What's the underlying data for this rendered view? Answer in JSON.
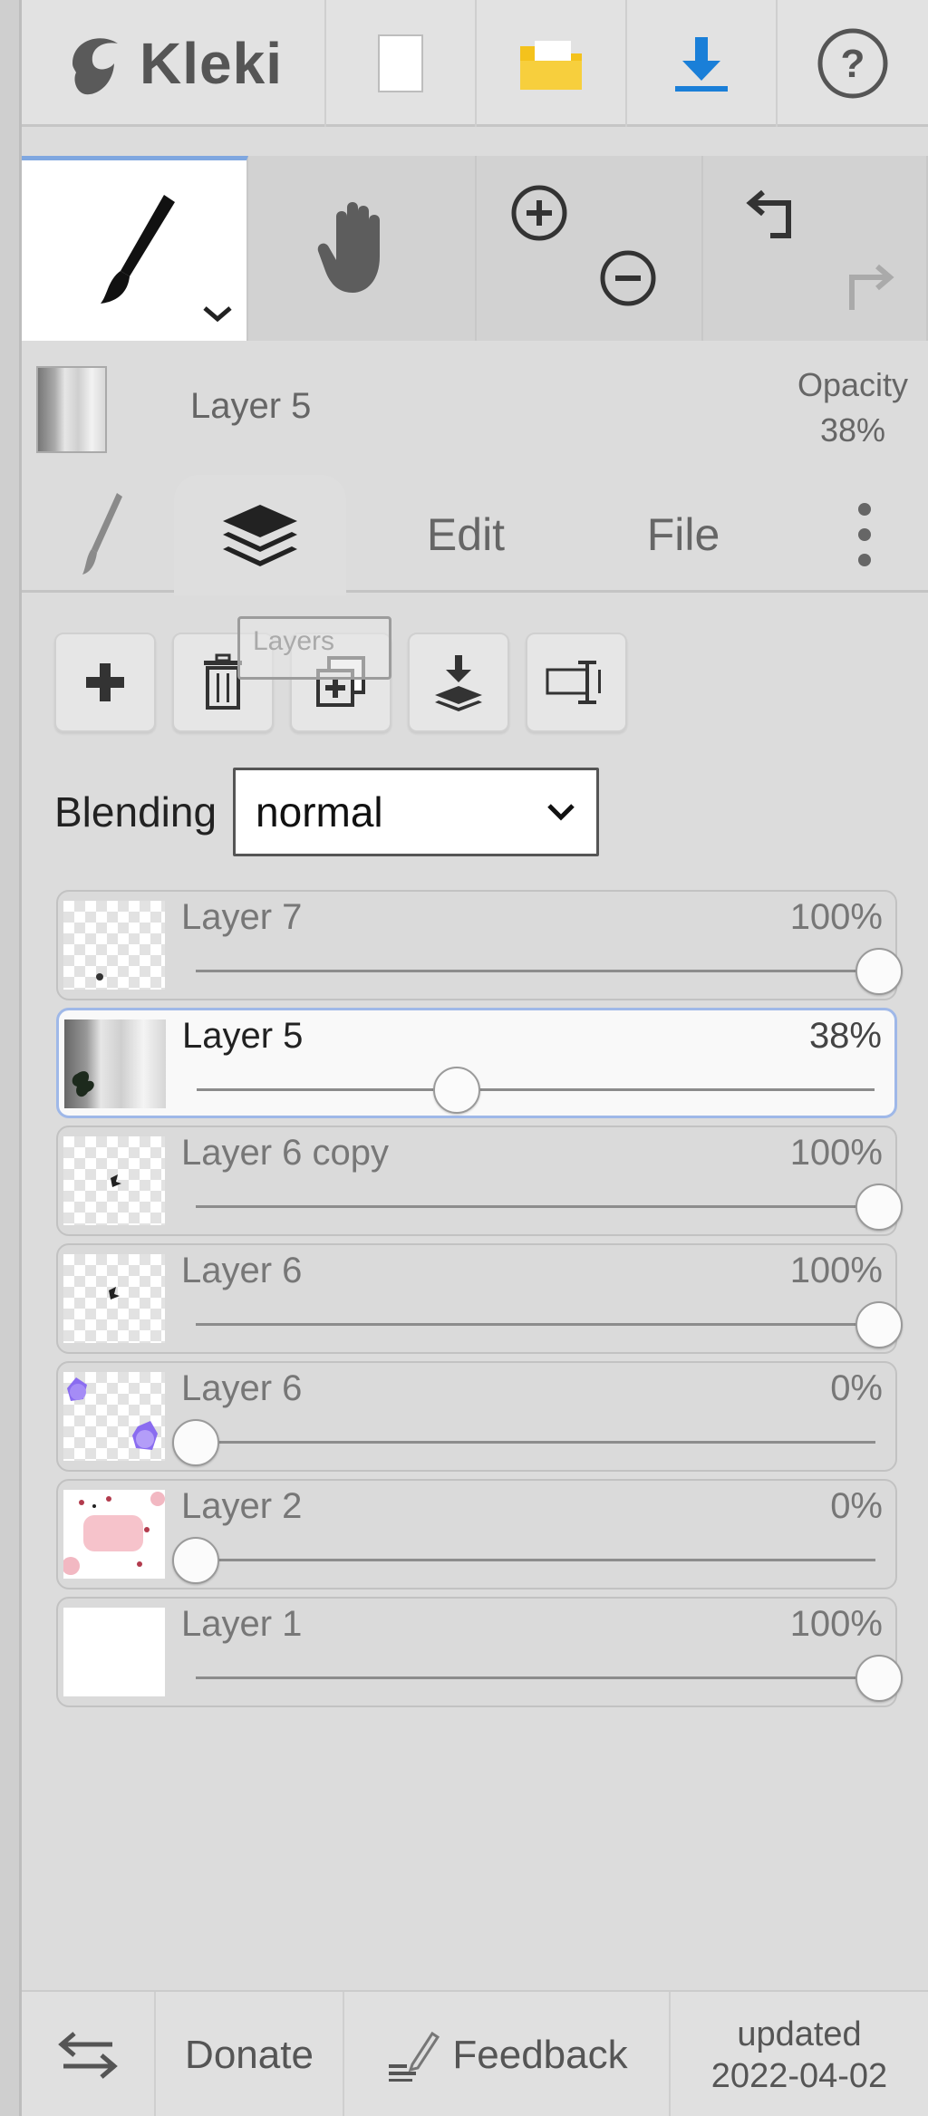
{
  "app": {
    "name": "Kleki"
  },
  "topbar": {
    "icons": [
      "kleki-logo-icon",
      "new-file-icon",
      "open-folder-icon",
      "download-icon",
      "help-icon"
    ],
    "accent_color": "#1a7fd8",
    "folder_color": "#f4c21c"
  },
  "tools": {
    "brush_active": true,
    "items": [
      "brush-tool",
      "hand-tool",
      "zoom-in",
      "zoom-out",
      "undo",
      "redo"
    ]
  },
  "current_layer": {
    "name": "Layer 5",
    "opacity_label": "Opacity",
    "opacity_value": "38%"
  },
  "tabs": [
    {
      "id": "brush",
      "label": ""
    },
    {
      "id": "layers",
      "label": "",
      "active": true
    },
    {
      "id": "edit",
      "label": "Edit"
    },
    {
      "id": "file",
      "label": "File"
    }
  ],
  "layer_buttons": {
    "tooltip": "Layers",
    "items": [
      "add-layer",
      "delete-layer",
      "duplicate-layer",
      "merge-layer",
      "rename-layer"
    ]
  },
  "blending": {
    "label": "Blending",
    "value": "normal"
  },
  "layers": [
    {
      "name": "Layer 7",
      "opacity": "100%",
      "value": 1.0,
      "thumb": "transparent"
    },
    {
      "name": "Layer 5",
      "opacity": "38%",
      "value": 0.38,
      "thumb": "photo",
      "active": true
    },
    {
      "name": "Layer 6 copy",
      "opacity": "100%",
      "value": 1.0,
      "thumb": "transparent"
    },
    {
      "name": "Layer 6",
      "opacity": "100%",
      "value": 1.0,
      "thumb": "transparent"
    },
    {
      "name": "Layer 6",
      "opacity": "0%",
      "value": 0.0,
      "thumb": "purple"
    },
    {
      "name": "Layer 2",
      "opacity": "0%",
      "value": 0.0,
      "thumb": "pink"
    },
    {
      "name": "Layer 1",
      "opacity": "100%",
      "value": 1.0,
      "thumb": "white"
    }
  ],
  "footer": {
    "donate": "Donate",
    "feedback": "Feedback",
    "updated_label": "updated",
    "updated_date": "2022-04-02"
  }
}
